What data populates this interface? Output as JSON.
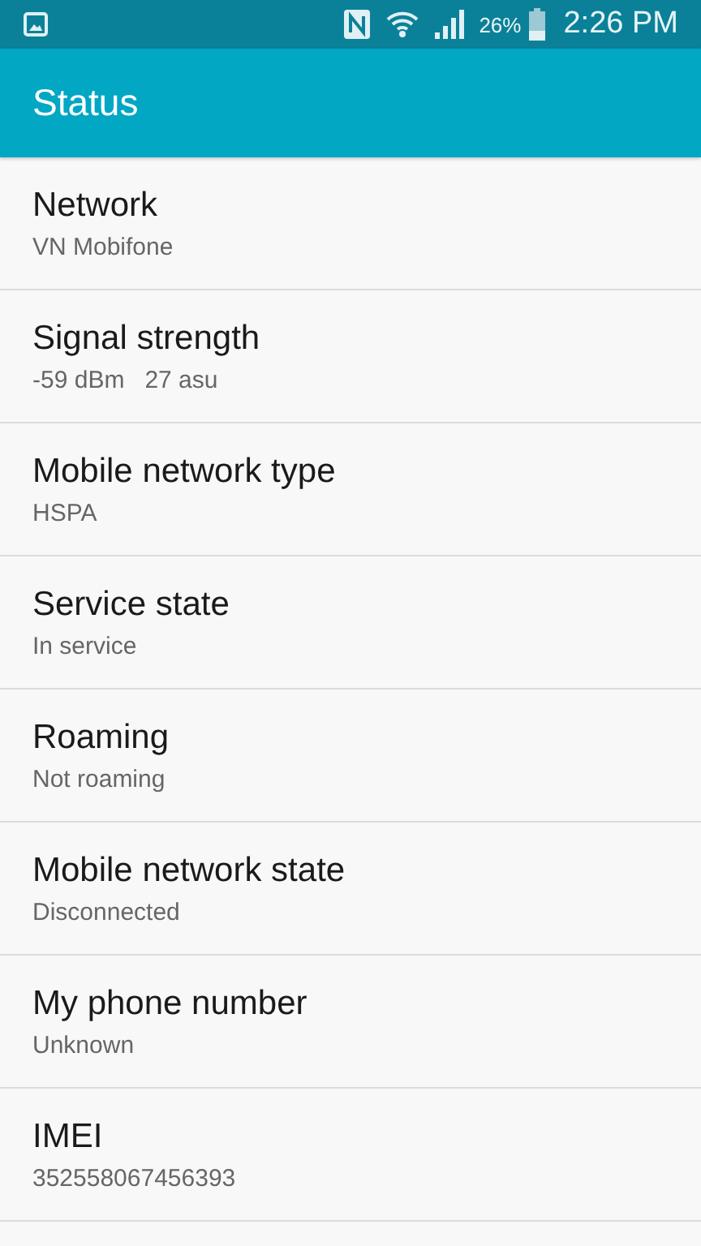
{
  "status_bar": {
    "battery_percent": "26%",
    "time": "2:26 PM"
  },
  "app_bar": {
    "title": "Status"
  },
  "items": [
    {
      "title": "Network",
      "summary": "VN Mobifone"
    },
    {
      "title": "Signal strength",
      "summary": "-59 dBm   27 asu"
    },
    {
      "title": "Mobile network type",
      "summary": "HSPA"
    },
    {
      "title": "Service state",
      "summary": "In service"
    },
    {
      "title": "Roaming",
      "summary": "Not roaming"
    },
    {
      "title": "Mobile network state",
      "summary": "Disconnected"
    },
    {
      "title": "My phone number",
      "summary": "Unknown"
    },
    {
      "title": "IMEI",
      "summary": "352558067456393"
    }
  ]
}
